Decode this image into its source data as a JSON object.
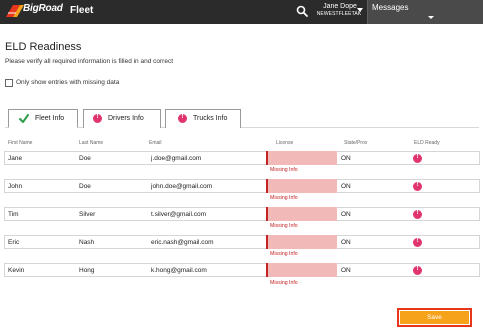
{
  "header": {
    "logo_text_left": "Big",
    "logo_text_right": "Road",
    "app_name": "Fleet",
    "user_name": "Jane Dope",
    "user_account": "NEWESTFLEETAK",
    "messages_label": "Messages",
    "colors": {
      "bar": "#2b2b2b",
      "logo": "#e8361c"
    }
  },
  "page": {
    "title": "ELD Readiness",
    "subtitle": "Please verify all required information is filled in and correct",
    "filter_label": "Only show entries with missing data",
    "filter_checked": false
  },
  "tabs": [
    {
      "label": "Fleet Info",
      "status": "complete",
      "icon": "check-icon"
    },
    {
      "label": "Drivers Info",
      "status": "incomplete",
      "icon": "alert-icon"
    },
    {
      "label": "Trucks Info",
      "status": "incomplete",
      "icon": "alert-icon"
    }
  ],
  "table": {
    "columns": [
      "First Name",
      "Last Name",
      "Email",
      "License",
      "State/Prov",
      "ELD Ready"
    ],
    "rows": [
      {
        "first": "Jane",
        "last": "Doe",
        "email": "j.doe@gmail.com",
        "license": "",
        "license_note": "Missing Info",
        "state": "ON",
        "eld_ready": false
      },
      {
        "first": "John",
        "last": "Doe",
        "email": "john.doe@gmail.com",
        "license": "",
        "license_note": "Missing Info",
        "state": "ON",
        "eld_ready": false
      },
      {
        "first": "Tim",
        "last": "Silver",
        "email": "t.silver@gmail.com",
        "license": "",
        "license_note": "Missing Info",
        "state": "ON",
        "eld_ready": false
      },
      {
        "first": "Eric",
        "last": "Nash",
        "email": "eric.nash@gmail.com",
        "license": "",
        "license_note": "Missing Info",
        "state": "ON",
        "eld_ready": false
      },
      {
        "first": "Kevin",
        "last": "Hong",
        "email": "k.hong@gmail.com",
        "license": "",
        "license_note": "Missing Info",
        "state": "ON",
        "eld_ready": false
      }
    ]
  },
  "actions": {
    "save_label": "Save",
    "save_color": "#f7a21b"
  }
}
